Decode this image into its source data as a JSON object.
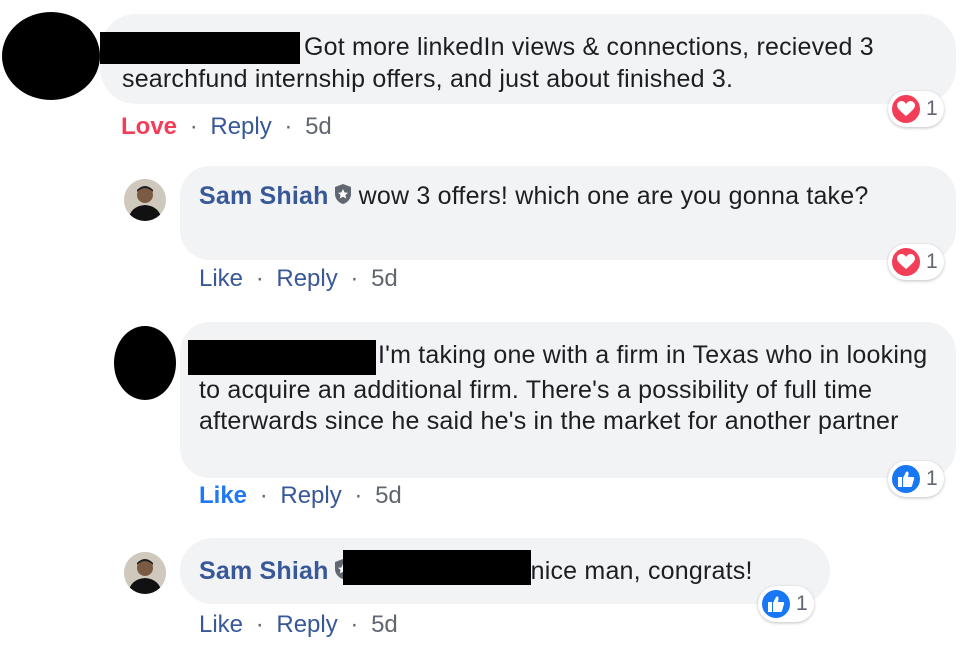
{
  "comments": [
    {
      "author": "",
      "text": "Got more linkedIn views & connections, recieved 3 searchfund internship offers, and just about finished 3.",
      "reaction_label": "Love",
      "reply_label": "Reply",
      "separator": "·",
      "time": "5d",
      "reaction_icon": "love-icon",
      "reaction_count": "1"
    },
    {
      "author": "Sam Shiah",
      "text": "wow 3 offers! which one are you gonna take?",
      "reaction_label": "Like",
      "reply_label": "Reply",
      "separator": "·",
      "time": "5d",
      "reaction_icon": "love-icon",
      "reaction_count": "1"
    },
    {
      "author": "",
      "text": "I'm taking one with a firm in Texas who in looking to acquire an additional firm. There's a possibility of full time afterwards since he said he's in the market for another partner",
      "reaction_label": "Like",
      "reply_label": "Reply",
      "separator": "·",
      "time": "5d",
      "reaction_icon": "like-icon",
      "reaction_count": "1"
    },
    {
      "author": "Sam Shiah",
      "text": "nice man, congrats!",
      "reaction_label": "Like",
      "reply_label": "Reply",
      "separator": "·",
      "time": "5d",
      "reaction_icon": "like-icon",
      "reaction_count": "1"
    }
  ],
  "colors": {
    "link": "#385898",
    "bubble": "#f2f3f5",
    "love": "#f33e58",
    "like_active": "#2078f4",
    "meta": "#606770"
  }
}
